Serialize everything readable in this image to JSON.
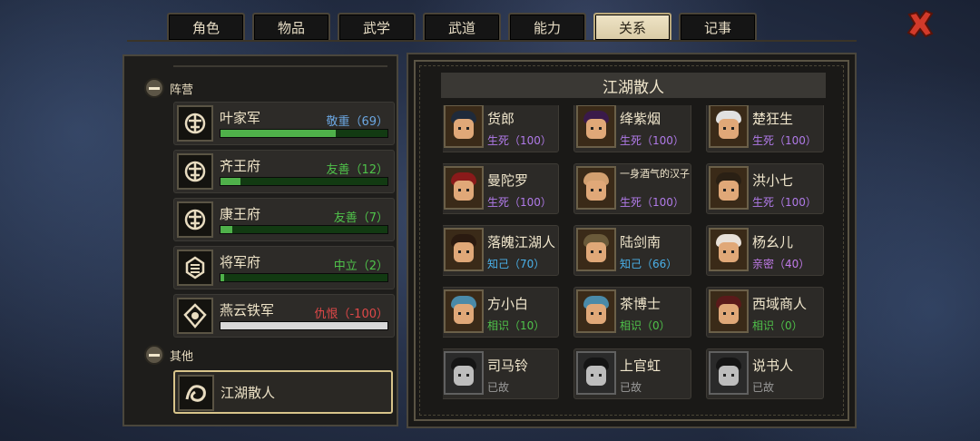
{
  "tabs": [
    "角色",
    "物品",
    "武学",
    "武道",
    "能力",
    "关系",
    "记事"
  ],
  "active_tab": 5,
  "colors": {
    "respect": "#6ba6e0",
    "friendly": "#4fc24a",
    "neutral": "#5fc24a",
    "hatred": "#e04848",
    "life_death": "#b07ae8",
    "close_friend": "#4ab0e8",
    "intimate": "#c07ae8",
    "acquaintance": "#4fc24a",
    "deceased": "#9a9a9a"
  },
  "factions_section": {
    "label": "阵营"
  },
  "factions": [
    {
      "name": "叶家军",
      "status": "敬重（69）",
      "status_color": "#6ba6e0",
      "level": 0.69,
      "icon": "tree-emblem-icon"
    },
    {
      "name": "齐王府",
      "status": "友善（12）",
      "status_color": "#4fc24a",
      "level": 0.12,
      "icon": "tree-emblem-icon"
    },
    {
      "name": "康王府",
      "status": "友善（7）",
      "status_color": "#4fc24a",
      "level": 0.07,
      "icon": "tree-emblem-icon"
    },
    {
      "name": "将军府",
      "status": "中立（2）",
      "status_color": "#4fc24a",
      "level": 0.02,
      "icon": "general-emblem-icon"
    },
    {
      "name": "燕云铁军",
      "status": "仇恨（-100）",
      "status_color": "#e04848",
      "level": 1.0,
      "hate": true,
      "icon": "iron-army-emblem-icon"
    }
  ],
  "other_section": {
    "label": "其他"
  },
  "other_item": {
    "name": "江湖散人",
    "icon": "wanderer-emblem-icon"
  },
  "panel_title": "江湖散人",
  "characters": [
    {
      "name": "货郎",
      "rel": "生死（100）",
      "color": "#b07ae8"
    },
    {
      "name": "绛紫烟",
      "rel": "生死（100）",
      "color": "#b07ae8"
    },
    {
      "name": "楚狂生",
      "rel": "生死（100）",
      "color": "#b07ae8"
    },
    {
      "name": "曼陀罗",
      "rel": "生死（100）",
      "color": "#b07ae8"
    },
    {
      "name": "一身酒气的汉子",
      "rel": "生死（100）",
      "color": "#b07ae8",
      "small": true
    },
    {
      "name": "洪小七",
      "rel": "生死（100）",
      "color": "#b07ae8"
    },
    {
      "name": "落魄江湖人",
      "rel": "知己（70）",
      "color": "#4ab0e8"
    },
    {
      "name": "陆剑南",
      "rel": "知己（66）",
      "color": "#4ab0e8"
    },
    {
      "name": "杨幺儿",
      "rel": "亲密（40）",
      "color": "#c07ae8"
    },
    {
      "name": "方小白",
      "rel": "相识（10）",
      "color": "#4fc24a"
    },
    {
      "name": "茶博士",
      "rel": "相识（0）",
      "color": "#4fc24a"
    },
    {
      "name": "西域商人",
      "rel": "相识（0）",
      "color": "#4fc24a"
    },
    {
      "name": "司马铃",
      "rel": "已故",
      "color": "#9a9a9a",
      "dead": true
    },
    {
      "name": "上官虹",
      "rel": "已故",
      "color": "#9a9a9a",
      "dead": true
    },
    {
      "name": "说书人",
      "rel": "已故",
      "color": "#9a9a9a",
      "dead": true
    }
  ]
}
